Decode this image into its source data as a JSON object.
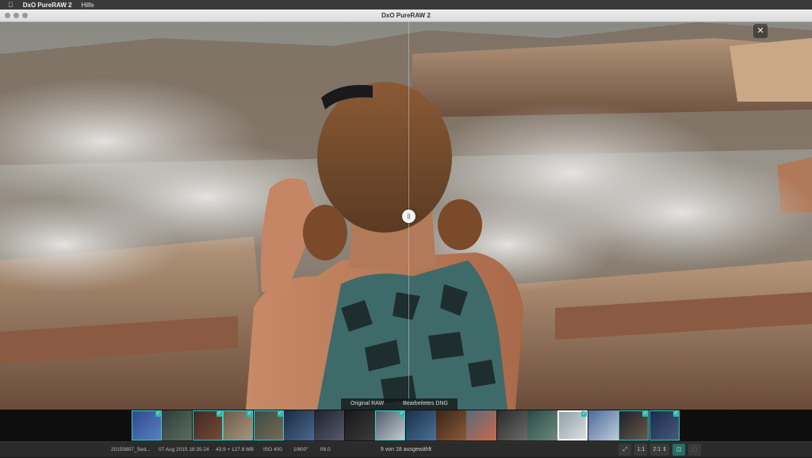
{
  "menubar": {
    "app_name": "DxO PureRAW 2",
    "menu_help": "Hilfe",
    "apple_icon": "apple-icon"
  },
  "window": {
    "title": "DxO PureRAW 2"
  },
  "viewer": {
    "close_label": "✕",
    "label_left": "Original RAW",
    "label_right": "Bearbeitetes DNG"
  },
  "filmstrip": {
    "accent": "#2fb8b1",
    "thumbnails": [
      {
        "checked": true,
        "c1": "#2c4a8c",
        "c2": "#5b7fc4"
      },
      {
        "checked": false,
        "c1": "#2f3c3a",
        "c2": "#5a6e62"
      },
      {
        "checked": true,
        "c1": "#3a2a24",
        "c2": "#7a4a34"
      },
      {
        "checked": true,
        "c1": "#6b5a48",
        "c2": "#a8967e"
      },
      {
        "checked": true,
        "c1": "#3a4a44",
        "c2": "#7a6a54"
      },
      {
        "checked": false,
        "c1": "#1a2a44",
        "c2": "#4a6a8c"
      },
      {
        "checked": false,
        "c1": "#1a2230",
        "c2": "#5a5a6a"
      },
      {
        "checked": false,
        "c1": "#181818",
        "c2": "#3a3a3a"
      },
      {
        "checked": true,
        "c1": "#4a5a6a",
        "c2": "#c8ccd0"
      },
      {
        "checked": false,
        "c1": "#1a3048",
        "c2": "#4a7098"
      },
      {
        "checked": false,
        "c1": "#3a2418",
        "c2": "#8a5a3a"
      },
      {
        "checked": false,
        "c1": "#5a6a7a",
        "c2": "#c86a4a"
      },
      {
        "checked": false,
        "c1": "#2a2a2a",
        "c2": "#6a6a6a"
      },
      {
        "checked": false,
        "c1": "#2a4a4a",
        "c2": "#6a8a7a"
      },
      {
        "checked": true,
        "c1": "#8a9aa4",
        "c2": "#e0e4e6"
      },
      {
        "checked": false,
        "c1": "#4a6a9a",
        "c2": "#c0ccdc"
      },
      {
        "checked": true,
        "c1": "#1a1e2a",
        "c2": "#6a5a4a"
      },
      {
        "checked": true,
        "c1": "#1a2a4a",
        "c2": "#4a5a7a"
      }
    ],
    "current_index": 14
  },
  "status": {
    "filename": "20150807_Sed...",
    "date": "07 Aug 2015 18:35:24",
    "size": "43.9 + 127.8 MB",
    "iso": "ISO 400",
    "shutter": "1/800\"",
    "aperture": "f/8.0",
    "selection": "9 von 18 ausgewählt",
    "zoom_fit": "1:1",
    "zoom_level": "2:1"
  }
}
